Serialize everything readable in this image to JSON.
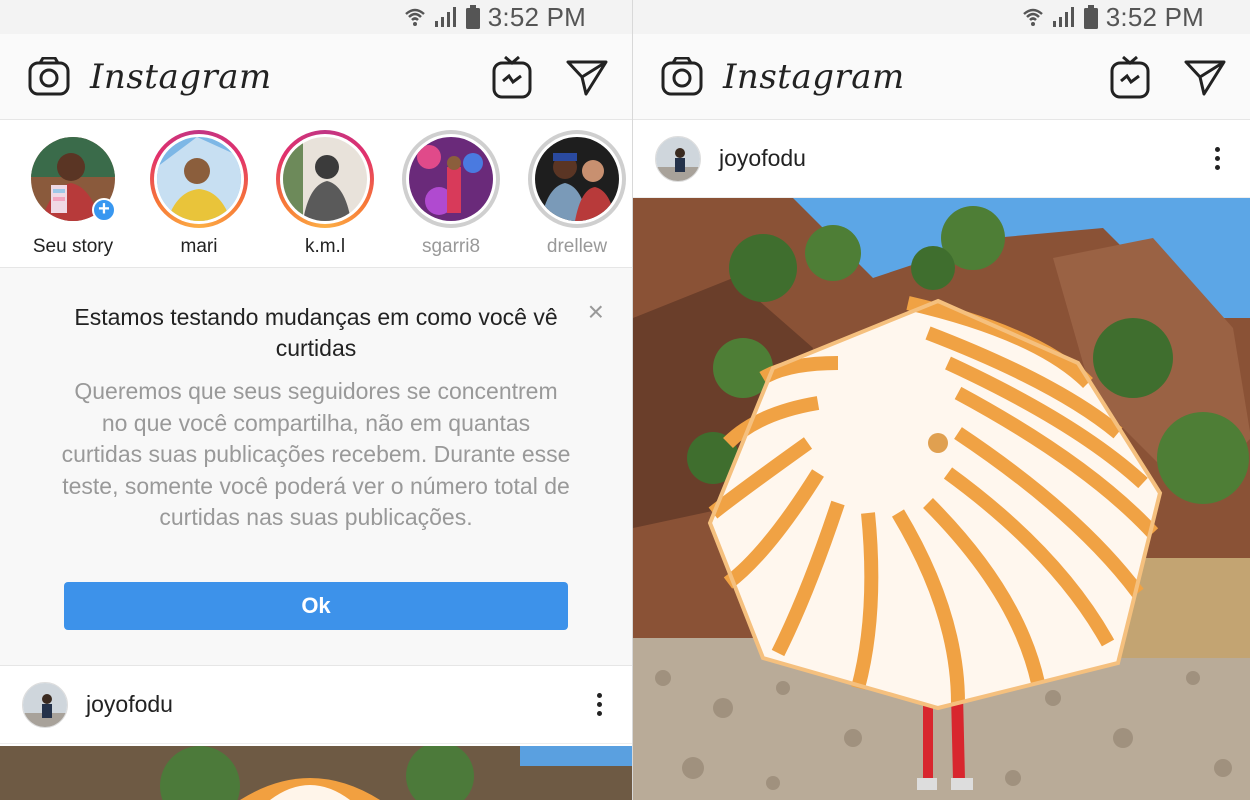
{
  "status_bar": {
    "time": "3:52 PM",
    "icons": [
      "wifi-icon",
      "signal-icon",
      "battery-icon"
    ]
  },
  "header": {
    "logo": "Instagram",
    "icons": [
      "camera-icon",
      "igtv-icon",
      "direct-message-icon"
    ]
  },
  "stories": [
    {
      "name": "Seu story",
      "state": "own"
    },
    {
      "name": "mari",
      "state": "unseen"
    },
    {
      "name": "k.m.l",
      "state": "unseen"
    },
    {
      "name": "sgarri8",
      "state": "seen"
    },
    {
      "name": "drellew",
      "state": "seen"
    }
  ],
  "notice": {
    "title": "Estamos testando mudanças em como você vê curtidas",
    "body": "Queremos que seus seguidores se concentrem no que você compartilha, não em quantas curtidas suas publicações recebem. Durante esse teste, somente você poderá ver o número total de curtidas nas suas publicações.",
    "ok_label": "Ok",
    "close_label": "×"
  },
  "post": {
    "username": "joyofodu",
    "more_icon": "more-options-icon"
  },
  "colors": {
    "accent": "#3d92ea",
    "text": "#222222",
    "muted": "#999999"
  }
}
